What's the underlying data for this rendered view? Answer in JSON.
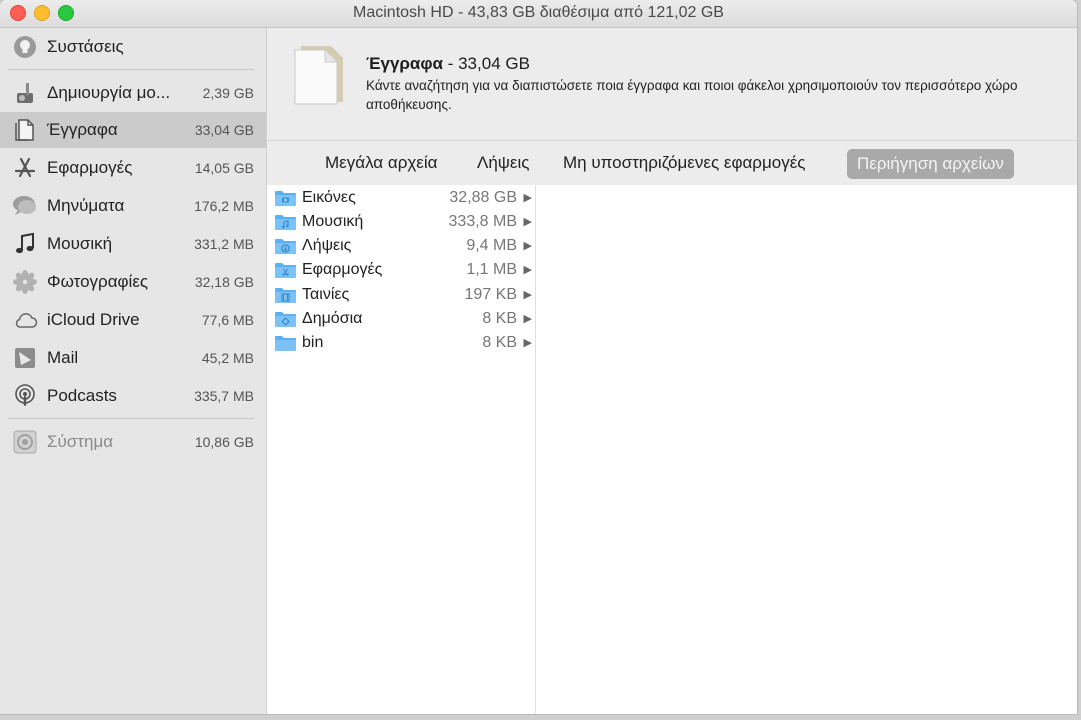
{
  "window": {
    "title": "Macintosh HD - 43,83 GB διαθέσιμα από 121,02 GB"
  },
  "sidebar": {
    "items": [
      {
        "icon": "lightbulb-icon",
        "label": "Συστάσεις",
        "size": ""
      },
      {
        "icon": "garageband-icon",
        "label": "Δημιουργία μο...",
        "size": "2,39 GB"
      },
      {
        "icon": "documents-icon",
        "label": "Έγγραφα",
        "size": "33,04 GB"
      },
      {
        "icon": "app-store-icon",
        "label": "Εφαρμογές",
        "size": "14,05 GB"
      },
      {
        "icon": "messages-icon",
        "label": "Μηνύματα",
        "size": "176,2 MB"
      },
      {
        "icon": "music-icon",
        "label": "Μουσική",
        "size": "331,2 MB"
      },
      {
        "icon": "photos-icon",
        "label": "Φωτογραφίες",
        "size": "32,18 GB"
      },
      {
        "icon": "icloud-icon",
        "label": "iCloud Drive",
        "size": "77,6 MB"
      },
      {
        "icon": "mail-icon",
        "label": "Mail",
        "size": "45,2 MB"
      },
      {
        "icon": "podcasts-icon",
        "label": "Podcasts",
        "size": "335,7 MB"
      },
      {
        "icon": "system-icon",
        "label": "Σύστημα",
        "size": "10,86 GB"
      }
    ],
    "selected_index": 2
  },
  "header": {
    "title": "Έγγραφα",
    "title_size": " - 33,04 GB",
    "description": "Κάντε αναζήτηση για να διαπιστώσετε ποια έγγραφα και ποιοι φάκελοι χρησιμοποιούν τον περισσότερο χώρο αποθήκευσης."
  },
  "tabs": [
    {
      "label": "Μεγάλα αρχεία",
      "active": false
    },
    {
      "label": "Λήψεις",
      "active": false
    },
    {
      "label": "Μη υποστηριζόμενες εφαρμογές",
      "active": false
    },
    {
      "label": "Περιήγηση αρχείων",
      "active": true
    }
  ],
  "browser": {
    "rows": [
      {
        "icon": "pictures-folder-icon",
        "name": "Εικόνες",
        "size": "32,88 GB"
      },
      {
        "icon": "music-folder-icon",
        "name": "Μουσική",
        "size": "333,8 MB"
      },
      {
        "icon": "downloads-folder-icon",
        "name": "Λήψεις",
        "size": "9,4 MB"
      },
      {
        "icon": "applications-folder-icon",
        "name": "Εφαρμογές",
        "size": "1,1 MB"
      },
      {
        "icon": "movies-folder-icon",
        "name": "Ταινίες",
        "size": "197 KB"
      },
      {
        "icon": "public-folder-icon",
        "name": "Δημόσια",
        "size": "8 KB"
      },
      {
        "icon": "folder-icon",
        "name": "bin",
        "size": "8 KB"
      }
    ],
    "arrow_glyph": "▶"
  },
  "colors": {
    "folder": "#5ab0f0",
    "selection": "#cbcbcb",
    "active_tab": "#a9a9a9"
  }
}
